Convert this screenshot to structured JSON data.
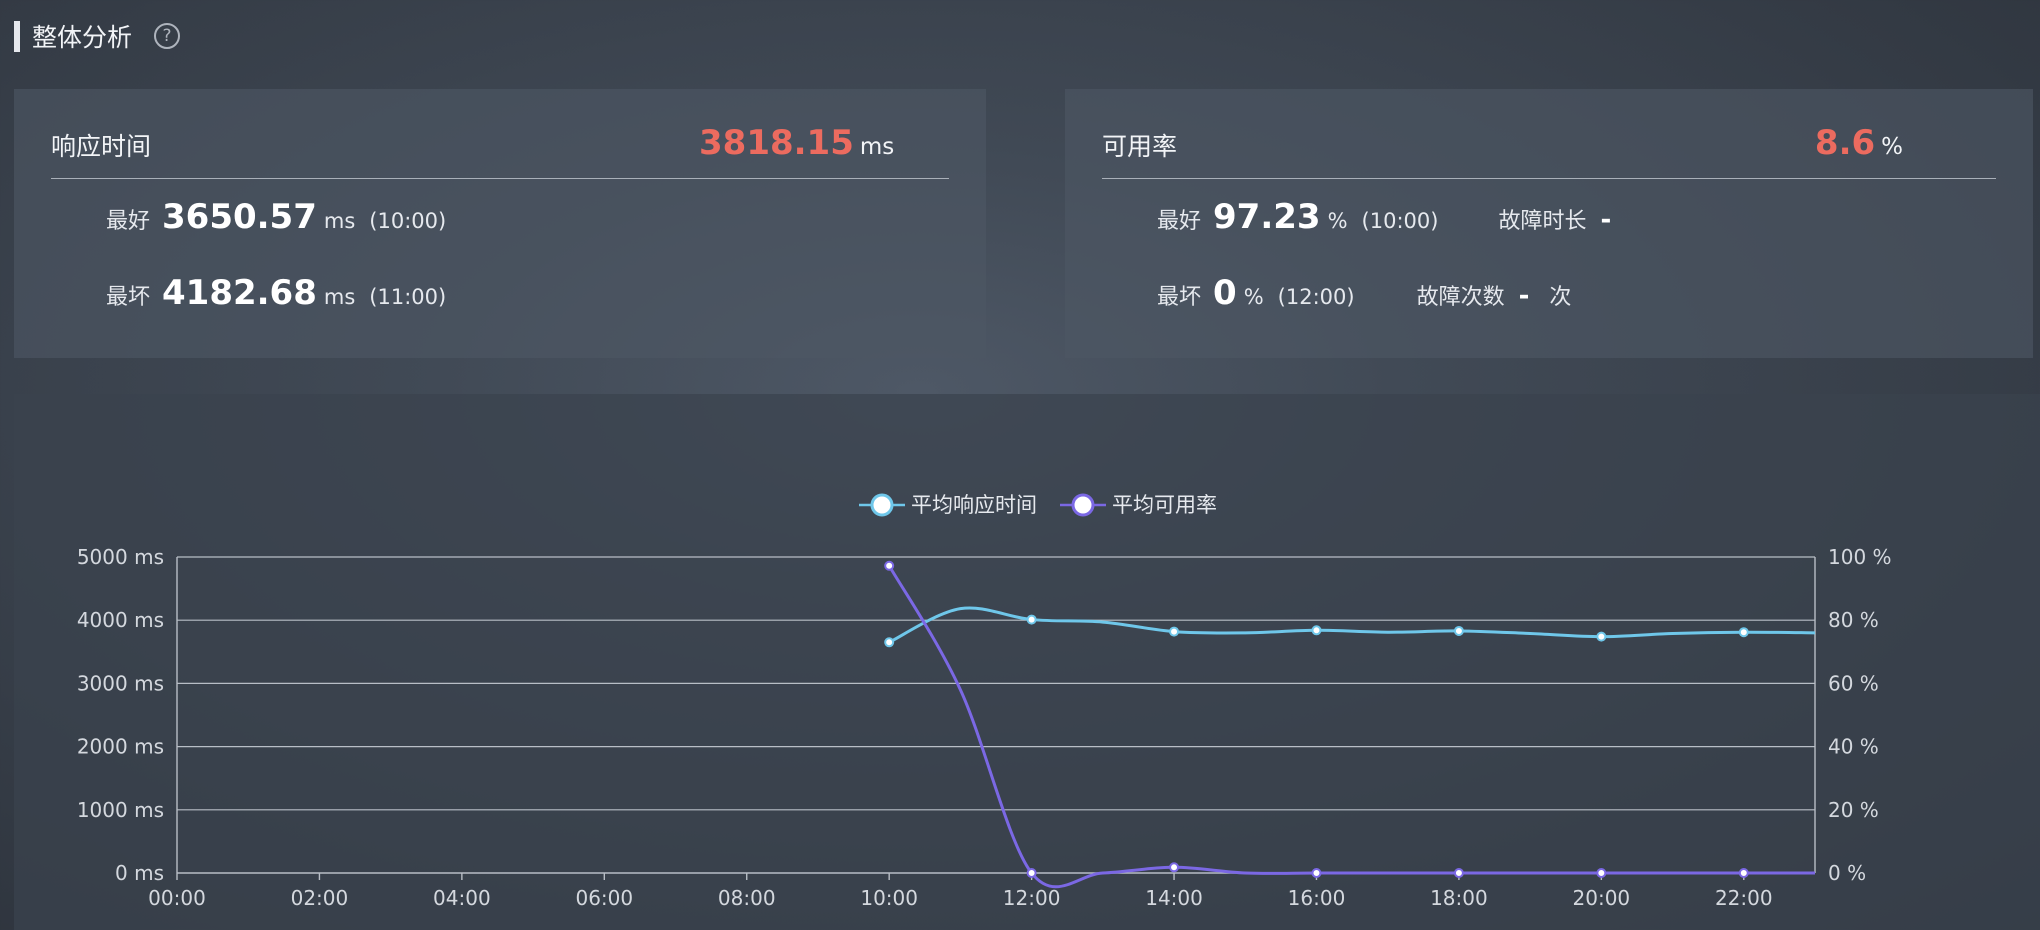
{
  "header": {
    "title": "整体分析",
    "help_icon": "question-circle-icon"
  },
  "response_card": {
    "title": "响应时间",
    "value": "3818.15",
    "unit": "ms",
    "best_label": "最好",
    "best_value": "3650.57",
    "best_unit": "ms",
    "best_time": "(10:00)",
    "worst_label": "最坏",
    "worst_value": "4182.68",
    "worst_unit": "ms",
    "worst_time": "(11:00)"
  },
  "availability_card": {
    "title": "可用率",
    "value": "8.6",
    "unit": "%",
    "best_label": "最好",
    "best_value": "97.23",
    "best_unit": "%",
    "best_time": "(10:00)",
    "worst_label": "最坏",
    "worst_value": "0",
    "worst_unit": "%",
    "worst_time": "(12:00)",
    "fault_duration_label": "故障时长",
    "fault_duration_value": "-",
    "fault_count_label": "故障次数",
    "fault_count_value": "-",
    "fault_count_unit": "次"
  },
  "colors": {
    "accent_red": "#ec6b5f",
    "series_response": "#6fc7ea",
    "series_availability": "#7b68e4"
  },
  "chart_data": {
    "type": "line",
    "x": [
      "10:00",
      "11:00",
      "12:00",
      "13:00",
      "14:00",
      "15:00",
      "16:00",
      "17:00",
      "18:00",
      "19:00",
      "20:00",
      "21:00",
      "22:00",
      "23:00"
    ],
    "x_ticks": [
      "00:00",
      "02:00",
      "04:00",
      "06:00",
      "08:00",
      "10:00",
      "12:00",
      "14:00",
      "16:00",
      "18:00",
      "20:00",
      "22:00"
    ],
    "x_range": [
      0,
      23
    ],
    "series": [
      {
        "name": "平均响应时间",
        "axis": "left",
        "color": "#6fc7ea",
        "values": [
          3650.57,
          4182.68,
          4010,
          3970,
          3820,
          3800,
          3840,
          3810,
          3830,
          3790,
          3740,
          3790,
          3810,
          3800
        ]
      },
      {
        "name": "平均可用率",
        "axis": "right",
        "color": "#7b68e4",
        "values": [
          97.23,
          58,
          0,
          0,
          1.8,
          0,
          0,
          0,
          0,
          0,
          0,
          0,
          0,
          0
        ]
      }
    ],
    "y_left": {
      "range": [
        0,
        5000
      ],
      "ticks": [
        "0 ms",
        "1000 ms",
        "2000 ms",
        "3000 ms",
        "4000 ms",
        "5000 ms"
      ]
    },
    "y_right": {
      "range": [
        0,
        100
      ],
      "ticks": [
        "0 %",
        "20 %",
        "40 %",
        "60 %",
        "80 %",
        "100 %"
      ]
    },
    "legend_position": "top-center",
    "grid": true
  }
}
